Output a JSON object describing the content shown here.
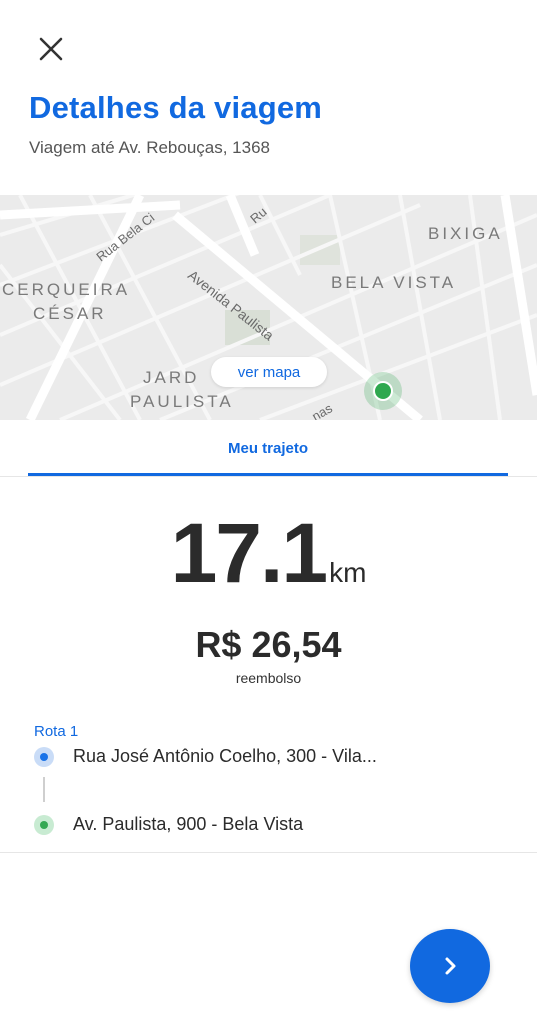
{
  "header": {
    "title": "Detalhes da viagem",
    "subtitle": "Viagem até Av. Rebouças, 1368"
  },
  "map": {
    "neighborhoods": [
      "BIXIGA",
      "BELA VISTA",
      "CERQUEIRA",
      "CÉSAR",
      "JARD",
      "PAULISTA"
    ],
    "streets": [
      "Rua Bela Ci",
      "Avenida Paulista",
      "Ru",
      "nas"
    ],
    "view_map_label": "ver mapa",
    "marker_color": "#2fa84f"
  },
  "tabs": [
    {
      "label": "Meu trajeto",
      "active": true
    }
  ],
  "trip": {
    "distance_value": "17.1",
    "distance_unit": "km",
    "price": "R$ 26,54",
    "price_caption": "reembolso"
  },
  "route": {
    "title": "Rota 1",
    "stops": [
      {
        "address": "Rua José Antônio Coelho, 300 - Vila...",
        "color": "#1a73e8"
      },
      {
        "address": "Av. Paulista, 900 - Bela Vista",
        "color": "#34a853"
      }
    ]
  },
  "icons": {
    "close": "close-icon",
    "next": "chevron-right-icon"
  },
  "colors": {
    "accent": "#1169e0",
    "text": "#2b2b2b"
  }
}
